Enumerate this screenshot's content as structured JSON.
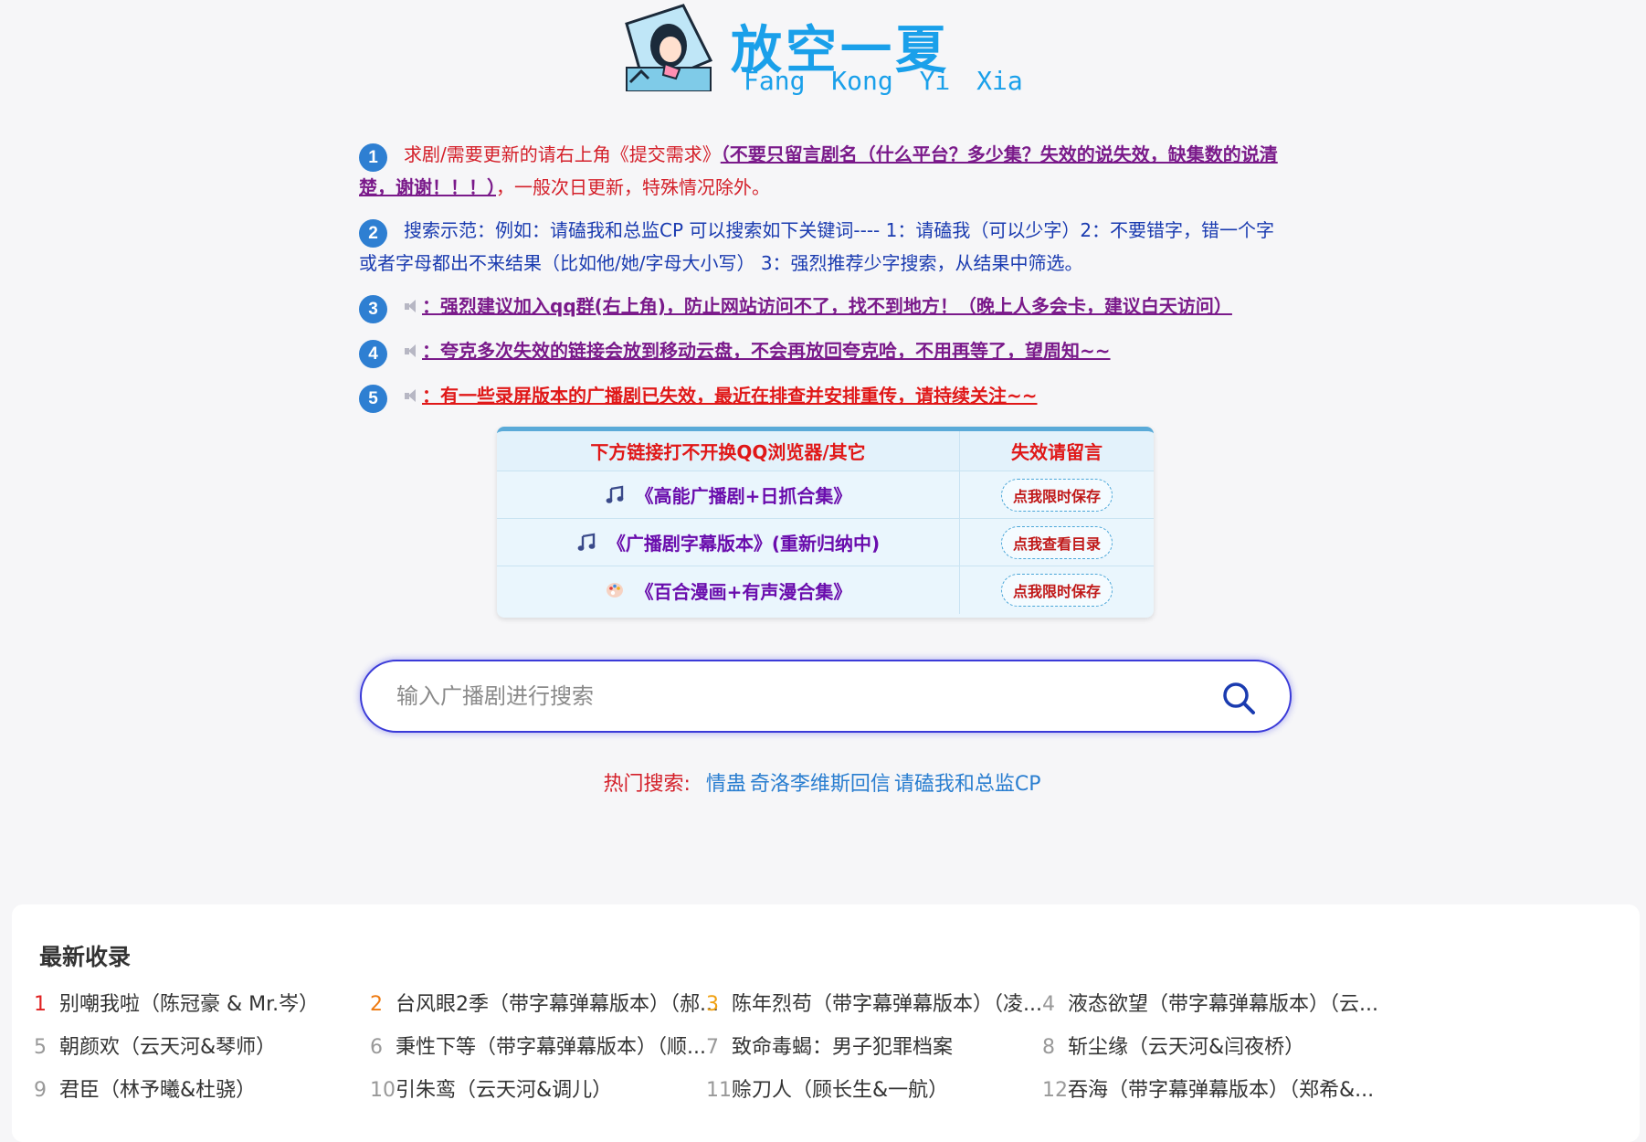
{
  "logo": {
    "cn": "放空一夏",
    "en": "Fang Kong Yi Xia"
  },
  "notices": [
    {
      "num": "1",
      "parts": [
        {
          "text": "求剧/需要更新的请右上角《提交需求》",
          "style": "red"
        },
        {
          "text": "（不要只留言剧名（什么平台？多少集？失效的说失效，缺集数的说清楚，谢谢！！！）",
          "style": "purple-bold"
        },
        {
          "text": "，一般次日更新，特殊情况除外。",
          "style": "red"
        }
      ]
    },
    {
      "num": "2",
      "parts": [
        {
          "text": "搜索示范：例如：请磕我和总监CP 可以搜索如下关键词---- 1：请磕我（可以少字）2：不要错字，错一个字或者字母都出不来结果（比如他/她/字母大小写） 3：强烈推荐少字搜索，从结果中筛选。",
          "style": "blue"
        }
      ]
    },
    {
      "num": "3",
      "speaker": true,
      "parts": [
        {
          "text": "：强烈建议加入qq群(右上角)，防止网站访问不了，找不到地方！（晚上人多会卡，建议白天访问）",
          "style": "purple-bold"
        }
      ]
    },
    {
      "num": "4",
      "speaker": true,
      "parts": [
        {
          "text": "：夸克多次失效的链接会放到移动云盘，不会再放回夸克哈，不用再等了，望周知~~",
          "style": "purple-bold"
        }
      ]
    },
    {
      "num": "5",
      "speaker": true,
      "parts": [
        {
          "text": "：有一些录屏版本的广播剧已失效，最近在排查并安排重传，请持续关注~~",
          "style": "red-bold"
        }
      ]
    }
  ],
  "link_table": {
    "header": [
      "下方链接打不开换QQ浏览器/其它",
      "失效请留言"
    ],
    "rows": [
      {
        "icon": "music-note-icon",
        "title": "《高能广播剧+日抓合集》",
        "button": "点我限时保存"
      },
      {
        "icon": "music-note-icon",
        "title": "《广播剧字幕版本》(重新归纳中)",
        "button": "点我查看目录"
      },
      {
        "icon": "palette-icon",
        "title": "《百合漫画+有声漫合集》",
        "button": "点我限时保存"
      }
    ]
  },
  "search": {
    "placeholder": "输入广播剧进行搜索",
    "value": ""
  },
  "hot": {
    "label": "热门搜索:",
    "items": [
      "情蛊",
      "奇洛李维斯回信",
      "请磕我和总监CP"
    ]
  },
  "latest": {
    "title": "最新收录",
    "items": [
      {
        "num": "1",
        "text": "别嘲我啦（陈冠豪 & Mr.岑）"
      },
      {
        "num": "2",
        "text": "台风眼2季（带字幕弹幕版本）（郝..."
      },
      {
        "num": "3",
        "text": "陈年烈苟（带字幕弹幕版本）（凌..."
      },
      {
        "num": "4",
        "text": "液态欲望（带字幕弹幕版本）（云..."
      },
      {
        "num": "5",
        "text": "朝颜欢（云天河&琴师）"
      },
      {
        "num": "6",
        "text": "秉性下等（带字幕弹幕版本）（顺..."
      },
      {
        "num": "7",
        "text": "致命毒蝎：男子犯罪档案"
      },
      {
        "num": "8",
        "text": "斩尘缘（云天河&闫夜桥）"
      },
      {
        "num": "9",
        "text": "君臣（林予曦&杜骁）"
      },
      {
        "num": "10",
        "text": "引朱鸾（云天河&调儿）"
      },
      {
        "num": "11",
        "text": "赊刀人（顾长生&一航）"
      },
      {
        "num": "12",
        "text": "吞海（带字幕弹幕版本）（郑希&..."
      }
    ]
  }
}
